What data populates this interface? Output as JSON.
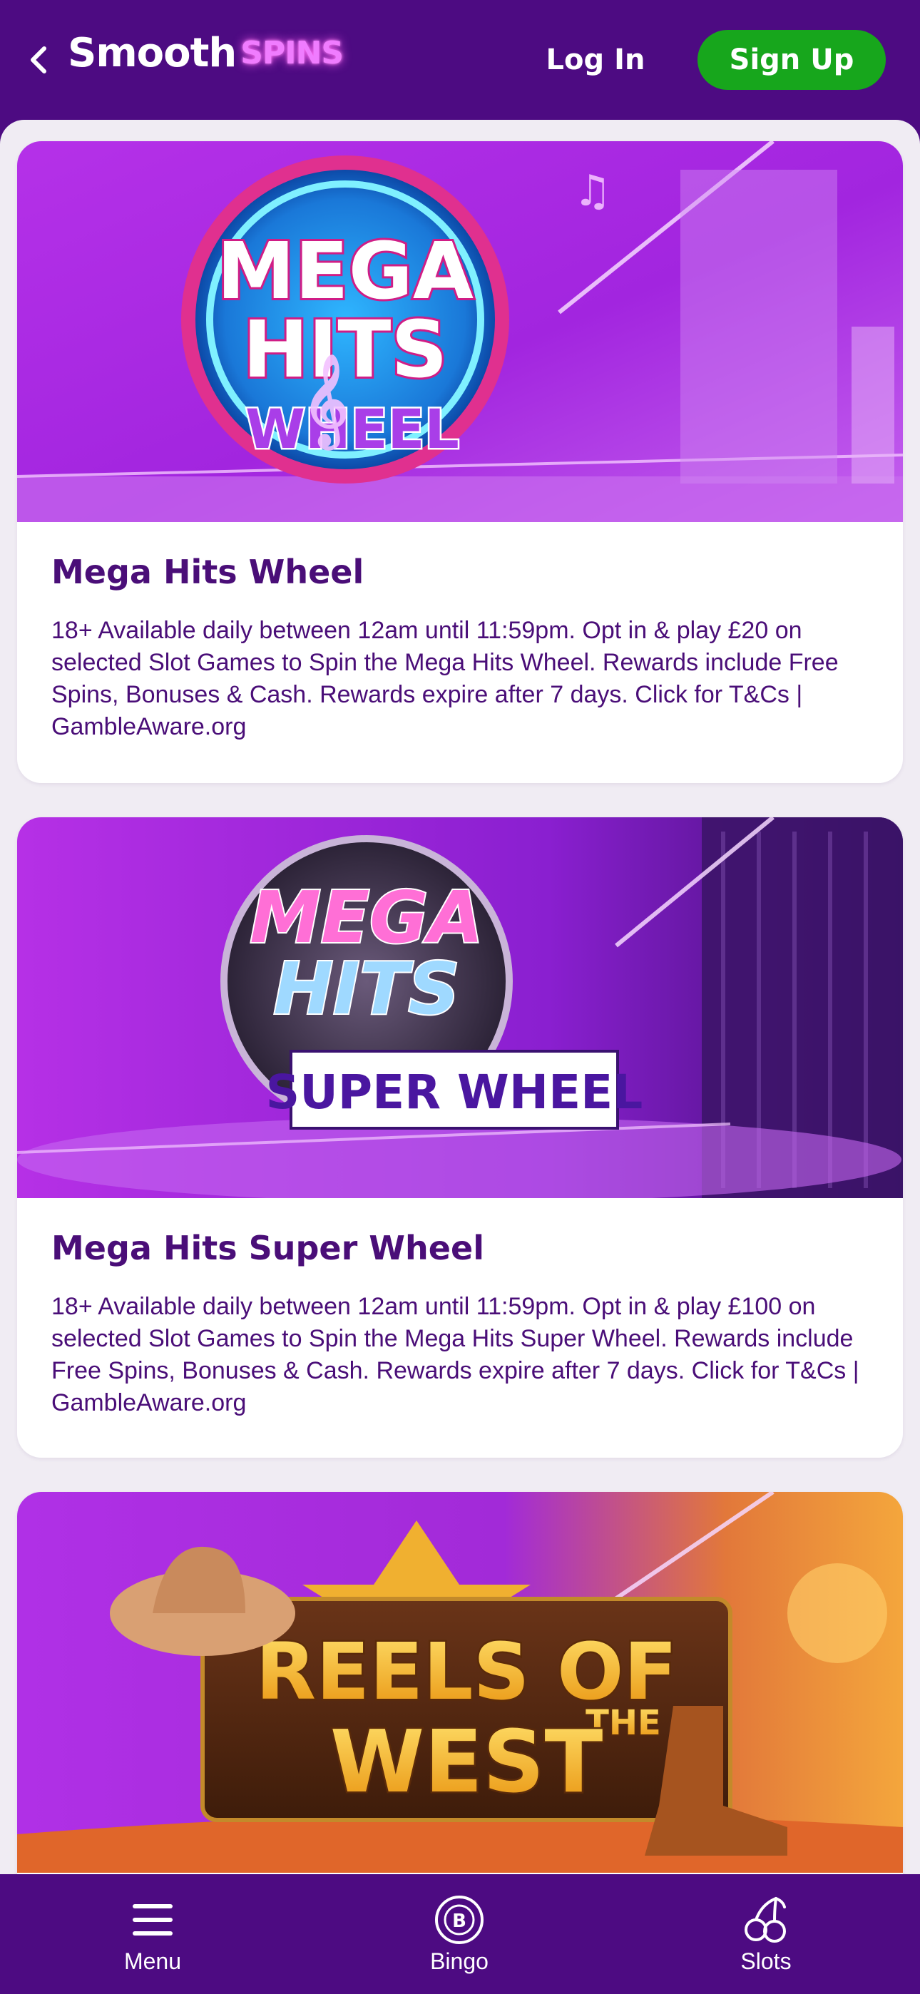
{
  "header": {
    "logo_main": "Smooth",
    "logo_accent": "SPINS",
    "login_label": "Log In",
    "signup_label": "Sign Up"
  },
  "promos": [
    {
      "banner_line1": "MEGA",
      "banner_line2": "HITS",
      "banner_line3": "WHEEL",
      "title": "Mega Hits Wheel",
      "description": "18+ Available daily between 12am until 11:59pm. Opt in & play £20 on selected Slot Games to Spin the Mega Hits Wheel. Rewards include Free Spins, Bonuses & Cash. Rewards expire after 7 days. Click for T&Cs | GambleAware.org"
    },
    {
      "banner_line1": "MEGA",
      "banner_line2": "HITS",
      "banner_line3": "SUPER WHEEL",
      "title": "Mega Hits Super Wheel",
      "description": "18+ Available daily between 12am until 11:59pm. Opt in & play £100 on selected Slot Games to Spin the Mega Hits Super Wheel. Rewards include Free Spins, Bonuses & Cash. Rewards expire after 7 days. Click for T&Cs | GambleAware.org"
    },
    {
      "banner_line1": "REELS OF",
      "banner_line2": "THE",
      "banner_line3": "WEST"
    }
  ],
  "bottom_nav": [
    {
      "label": "Menu",
      "icon": "hamburger-icon"
    },
    {
      "label": "Bingo",
      "icon": "bingo-ball-icon"
    },
    {
      "label": "Slots",
      "icon": "cherries-icon"
    }
  ],
  "colors": {
    "brand_purple": "#4d0b82",
    "signup_green": "#17a61c",
    "title_purple": "#4a0e78",
    "banner_magenta": "#b52be6"
  }
}
